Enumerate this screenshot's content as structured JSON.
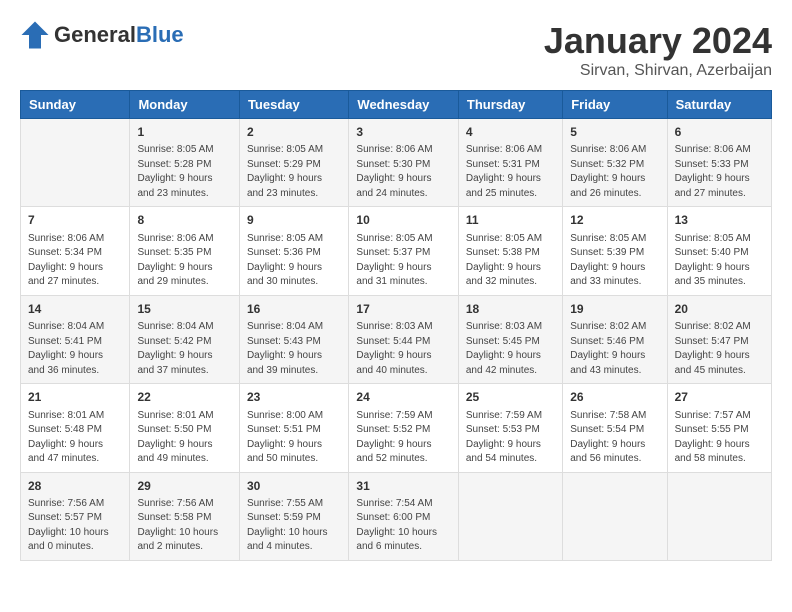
{
  "logo": {
    "general": "General",
    "blue": "Blue"
  },
  "title": "January 2024",
  "location": "Sirvan, Shirvan, Azerbaijan",
  "days_header": [
    "Sunday",
    "Monday",
    "Tuesday",
    "Wednesday",
    "Thursday",
    "Friday",
    "Saturday"
  ],
  "weeks": [
    [
      {
        "day": "",
        "content": ""
      },
      {
        "day": "1",
        "content": "Sunrise: 8:05 AM\nSunset: 5:28 PM\nDaylight: 9 hours\nand 23 minutes."
      },
      {
        "day": "2",
        "content": "Sunrise: 8:05 AM\nSunset: 5:29 PM\nDaylight: 9 hours\nand 23 minutes."
      },
      {
        "day": "3",
        "content": "Sunrise: 8:06 AM\nSunset: 5:30 PM\nDaylight: 9 hours\nand 24 minutes."
      },
      {
        "day": "4",
        "content": "Sunrise: 8:06 AM\nSunset: 5:31 PM\nDaylight: 9 hours\nand 25 minutes."
      },
      {
        "day": "5",
        "content": "Sunrise: 8:06 AM\nSunset: 5:32 PM\nDaylight: 9 hours\nand 26 minutes."
      },
      {
        "day": "6",
        "content": "Sunrise: 8:06 AM\nSunset: 5:33 PM\nDaylight: 9 hours\nand 27 minutes."
      }
    ],
    [
      {
        "day": "7",
        "content": "Sunrise: 8:06 AM\nSunset: 5:34 PM\nDaylight: 9 hours\nand 27 minutes."
      },
      {
        "day": "8",
        "content": "Sunrise: 8:06 AM\nSunset: 5:35 PM\nDaylight: 9 hours\nand 29 minutes."
      },
      {
        "day": "9",
        "content": "Sunrise: 8:05 AM\nSunset: 5:36 PM\nDaylight: 9 hours\nand 30 minutes."
      },
      {
        "day": "10",
        "content": "Sunrise: 8:05 AM\nSunset: 5:37 PM\nDaylight: 9 hours\nand 31 minutes."
      },
      {
        "day": "11",
        "content": "Sunrise: 8:05 AM\nSunset: 5:38 PM\nDaylight: 9 hours\nand 32 minutes."
      },
      {
        "day": "12",
        "content": "Sunrise: 8:05 AM\nSunset: 5:39 PM\nDaylight: 9 hours\nand 33 minutes."
      },
      {
        "day": "13",
        "content": "Sunrise: 8:05 AM\nSunset: 5:40 PM\nDaylight: 9 hours\nand 35 minutes."
      }
    ],
    [
      {
        "day": "14",
        "content": "Sunrise: 8:04 AM\nSunset: 5:41 PM\nDaylight: 9 hours\nand 36 minutes."
      },
      {
        "day": "15",
        "content": "Sunrise: 8:04 AM\nSunset: 5:42 PM\nDaylight: 9 hours\nand 37 minutes."
      },
      {
        "day": "16",
        "content": "Sunrise: 8:04 AM\nSunset: 5:43 PM\nDaylight: 9 hours\nand 39 minutes."
      },
      {
        "day": "17",
        "content": "Sunrise: 8:03 AM\nSunset: 5:44 PM\nDaylight: 9 hours\nand 40 minutes."
      },
      {
        "day": "18",
        "content": "Sunrise: 8:03 AM\nSunset: 5:45 PM\nDaylight: 9 hours\nand 42 minutes."
      },
      {
        "day": "19",
        "content": "Sunrise: 8:02 AM\nSunset: 5:46 PM\nDaylight: 9 hours\nand 43 minutes."
      },
      {
        "day": "20",
        "content": "Sunrise: 8:02 AM\nSunset: 5:47 PM\nDaylight: 9 hours\nand 45 minutes."
      }
    ],
    [
      {
        "day": "21",
        "content": "Sunrise: 8:01 AM\nSunset: 5:48 PM\nDaylight: 9 hours\nand 47 minutes."
      },
      {
        "day": "22",
        "content": "Sunrise: 8:01 AM\nSunset: 5:50 PM\nDaylight: 9 hours\nand 49 minutes."
      },
      {
        "day": "23",
        "content": "Sunrise: 8:00 AM\nSunset: 5:51 PM\nDaylight: 9 hours\nand 50 minutes."
      },
      {
        "day": "24",
        "content": "Sunrise: 7:59 AM\nSunset: 5:52 PM\nDaylight: 9 hours\nand 52 minutes."
      },
      {
        "day": "25",
        "content": "Sunrise: 7:59 AM\nSunset: 5:53 PM\nDaylight: 9 hours\nand 54 minutes."
      },
      {
        "day": "26",
        "content": "Sunrise: 7:58 AM\nSunset: 5:54 PM\nDaylight: 9 hours\nand 56 minutes."
      },
      {
        "day": "27",
        "content": "Sunrise: 7:57 AM\nSunset: 5:55 PM\nDaylight: 9 hours\nand 58 minutes."
      }
    ],
    [
      {
        "day": "28",
        "content": "Sunrise: 7:56 AM\nSunset: 5:57 PM\nDaylight: 10 hours\nand 0 minutes."
      },
      {
        "day": "29",
        "content": "Sunrise: 7:56 AM\nSunset: 5:58 PM\nDaylight: 10 hours\nand 2 minutes."
      },
      {
        "day": "30",
        "content": "Sunrise: 7:55 AM\nSunset: 5:59 PM\nDaylight: 10 hours\nand 4 minutes."
      },
      {
        "day": "31",
        "content": "Sunrise: 7:54 AM\nSunset: 6:00 PM\nDaylight: 10 hours\nand 6 minutes."
      },
      {
        "day": "",
        "content": ""
      },
      {
        "day": "",
        "content": ""
      },
      {
        "day": "",
        "content": ""
      }
    ]
  ]
}
